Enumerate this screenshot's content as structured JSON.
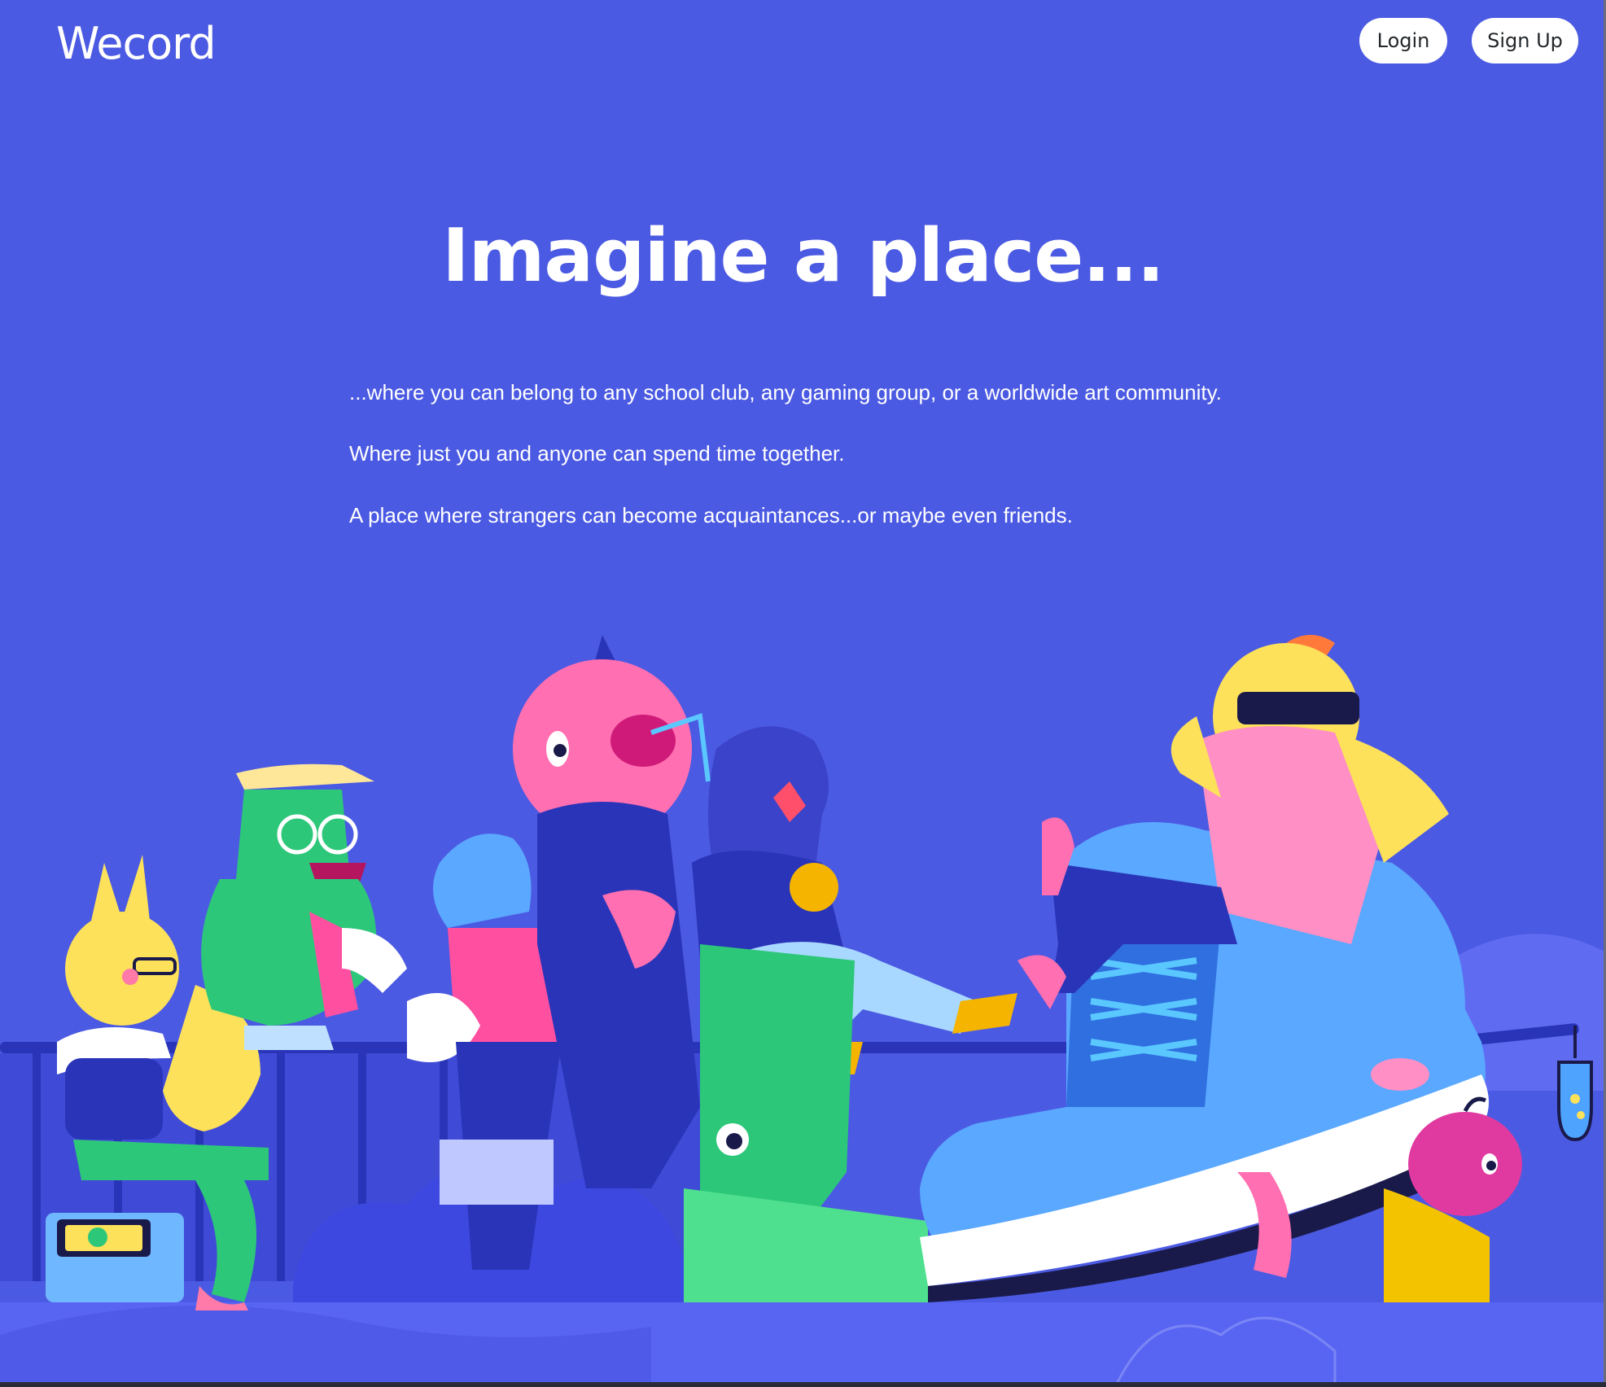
{
  "header": {
    "logo_text": "Wecord",
    "login_label": "Login",
    "signup_label": "Sign Up"
  },
  "hero": {
    "title": "Imagine a place...",
    "lines": [
      "...where you can belong to any school club, any gaming group, or a worldwide art community.",
      "Where just you and anyone can spend time together.",
      "A place where strangers can become acquaintances...or maybe even friends."
    ]
  },
  "colors": {
    "background": "#4b5ae2",
    "text": "#ffffff",
    "button_bg": "#ffffff",
    "button_text": "#23272a"
  },
  "illustration": {
    "characters": [
      "bunny",
      "green-dino-with-cap",
      "blue-creature",
      "pink-head-character",
      "blue-hooded-character",
      "yellow-character-with-sunglasses",
      "pink-apple"
    ],
    "objects": [
      "giant-sneaker",
      "handheld-game-console",
      "green-boot",
      "hanging-jar"
    ]
  }
}
